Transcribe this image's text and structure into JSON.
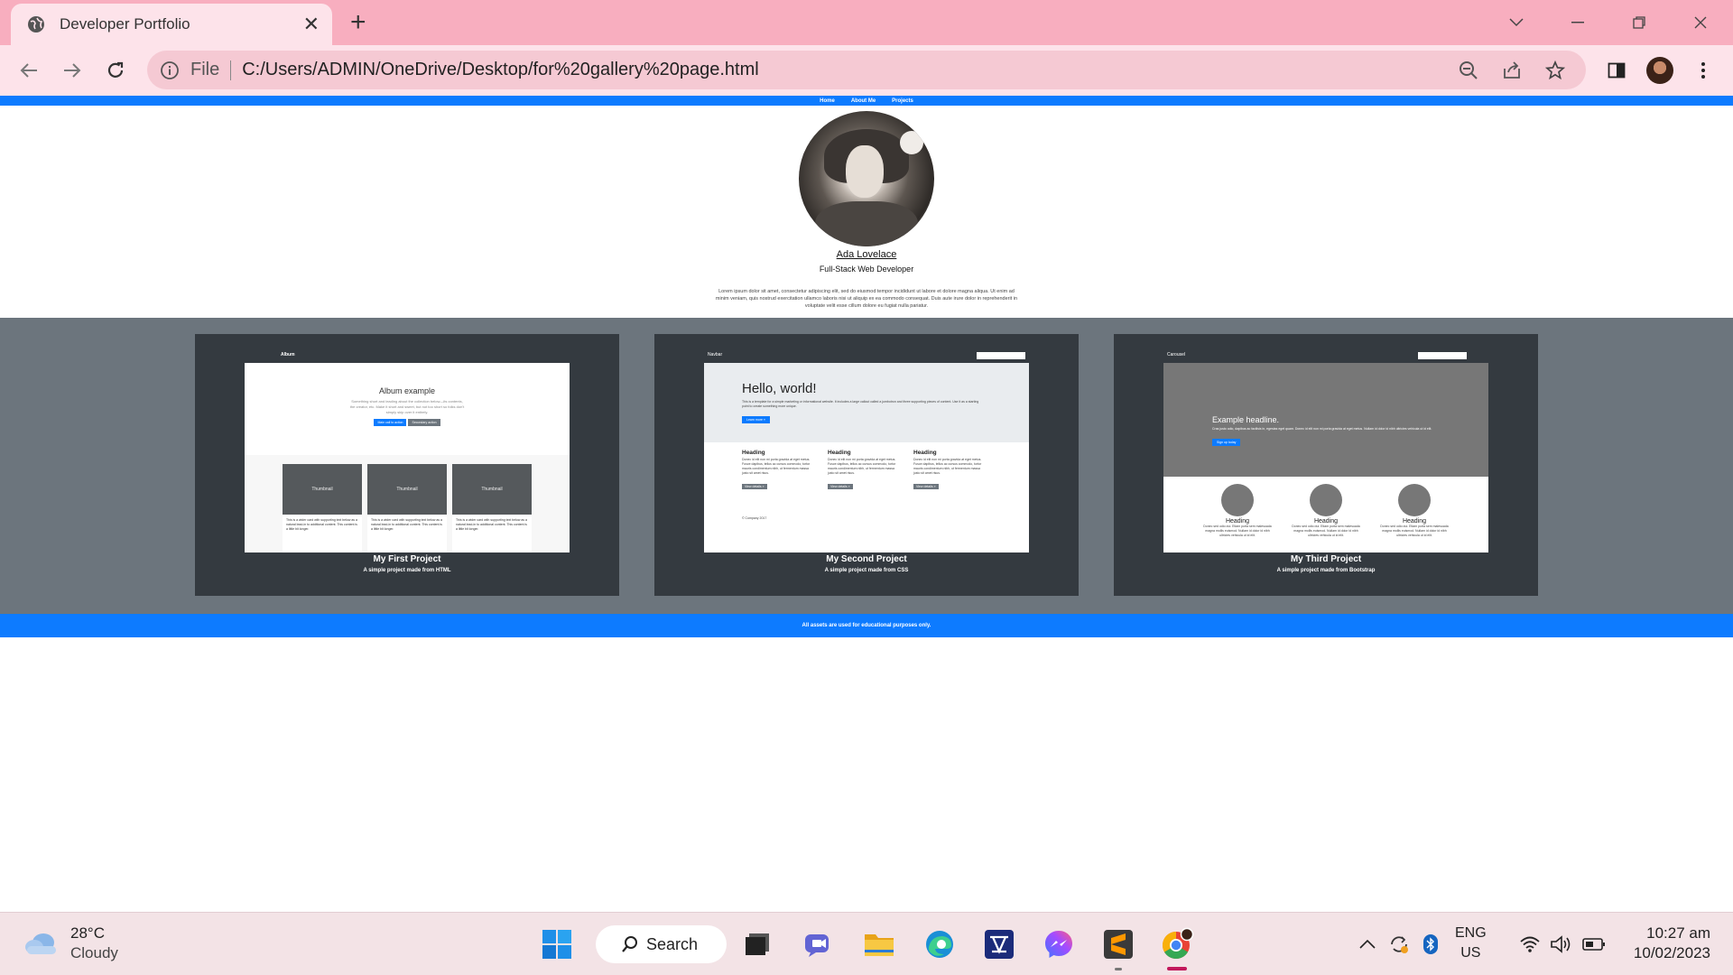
{
  "browser": {
    "tab_title": "Developer Portfolio",
    "omnibox_scheme": "File",
    "url": "C:/Users/ADMIN/OneDrive/Desktop/for%20gallery%20page.html"
  },
  "site": {
    "nav": [
      "Home",
      "About Me",
      "Projects"
    ],
    "name": "Ada Lovelace",
    "role": "Full-Stack Web Developer",
    "bio": "Lorem ipsum dolor sit amet, consectetur adipiscing elit, sed do eiusmod tempor incididunt ut labore et dolore magna aliqua. Ut enim ad minim veniam, quis nostrud exercitation ullamco laboris nisi ut aliquip ex ea commodo consequat. Duis aute irure dolor in reprehenderit in voluptate velit esse cillum dolore eu fugiat nulla pariatur.",
    "projects": [
      {
        "title": "My First Project",
        "subtitle": "A simple project made from HTML",
        "preview": {
          "brand": "Album",
          "heading": "Album example",
          "text": "Something short and leading about the collection below—its contents, the creator, etc. Make it short and sweet, but not too short so folks don't simply skip over it entirely.",
          "primary_btn": "Main call to action",
          "secondary_btn": "Secondary action",
          "thumb_label": "Thumbnail",
          "card_text": "This is a wider card with supporting text below as a natural lead-in to additional content. This content is a little bit longer."
        }
      },
      {
        "title": "My Second Project",
        "subtitle": "A simple project made from CSS",
        "preview": {
          "brand": "Navbar",
          "heading": "Hello, world!",
          "text": "This is a template for a simple marketing or informational website. It includes a large callout called a jumbotron and three supporting pieces of content. Use it as a starting point to create something more unique.",
          "cta": "Learn more »",
          "col_heading": "Heading",
          "col_text": "Donec id elit non mi porta gravida at eget metus. Fusce dapibus, tellus ac cursus commodo, tortor mauris condimentum nibh, ut fermentum massa justo sit amet risus.",
          "col_btn": "View details »",
          "footer": "© Company 2017"
        }
      },
      {
        "title": "My Third Project",
        "subtitle": "A simple project made from Bootstrap",
        "preview": {
          "brand": "Carousel",
          "heading": "Example headline.",
          "text": "Cras justo odio, dapibus ac facilisis in, egestas eget quam. Donec id elit non mi porta gravida at eget metus. Nullam id dolor id nibh ultricies vehicula ut id elit.",
          "cta": "Sign up today",
          "col_heading": "Heading",
          "col_text": "Donec sed odio dui. Etiam porta sem malesuada magna mollis euismod. Nullam id dolor id nibh ultricies vehicula ut id elit."
        }
      }
    ],
    "footer": "All assets are used for educational purposes only."
  },
  "taskbar": {
    "temperature": "28°C",
    "condition": "Cloudy",
    "search_label": "Search",
    "lang_line1": "ENG",
    "lang_line2": "US",
    "time": "10:27 am",
    "date": "10/02/2023"
  },
  "colors": {
    "tabstrip": "#f8aebf",
    "toolbar": "#fde3ea",
    "site_accent": "#0d7bff",
    "gallery_bg": "#6c757d",
    "card_bg": "#343a40"
  }
}
